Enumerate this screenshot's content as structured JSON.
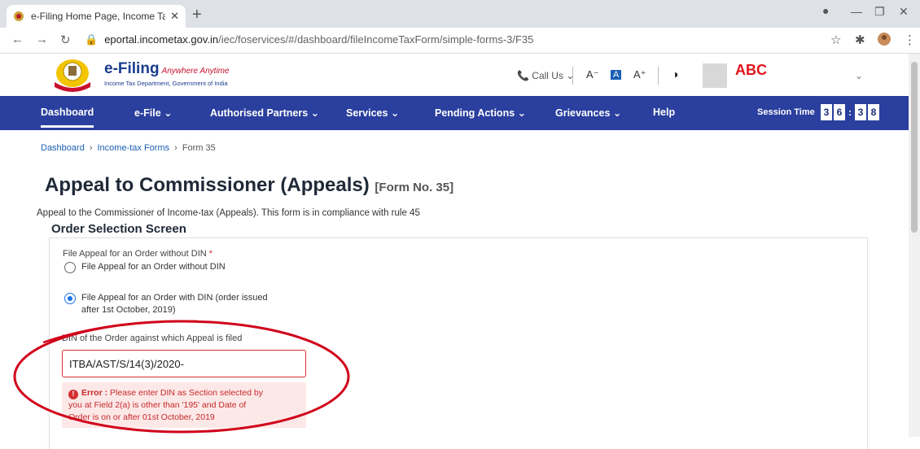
{
  "browser": {
    "tab_title": "e-Filing Home Page, Income Tax",
    "url_host": "eportal.incometax.gov.in",
    "url_path": "/iec/foservices/#/dashboard/fileIncomeTaxForm/simple-forms-3/F35"
  },
  "header": {
    "brand_title": "e-Filing",
    "brand_tagline": "Anywhere Anytime",
    "brand_subtitle": "Income Tax Department, Government of India",
    "call_us": "Call Us",
    "font_decrease": "A⁻",
    "font_reset": "A",
    "font_increase": "A⁺",
    "username": "ABC"
  },
  "nav": {
    "items": [
      {
        "label": "Dashboard"
      },
      {
        "label": "e-File ⌄"
      },
      {
        "label": "Authorised Partners ⌄"
      },
      {
        "label": "Services ⌄"
      },
      {
        "label": "Pending Actions ⌄"
      },
      {
        "label": "Grievances ⌄"
      },
      {
        "label": "Help"
      }
    ],
    "session_label": "Session Time",
    "session_digits": [
      "3",
      "6",
      ":",
      "3",
      "8"
    ]
  },
  "breadcrumb": {
    "items": [
      "Dashboard",
      "Income-tax Forms",
      "Form 35"
    ]
  },
  "page": {
    "title": "Appeal to Commissioner (Appeals)",
    "form_no": "[Form No. 35]",
    "description": "Appeal to the Commissioner of Income-tax (Appeals). This form is in compliance with rule 45",
    "section_title": "Order Selection Screen"
  },
  "form": {
    "field_label": "File Appeal for an Order without DIN",
    "required_mark": "*",
    "option_without_din": "File Appeal for an Order without DIN",
    "option_with_din_line1": "File Appeal for an Order with DIN (order issued",
    "option_with_din_line2": "after 1st October, 2019)",
    "din_label": "DIN of the Order against which Appeal is filed",
    "din_value": "ITBA/AST/S/14(3)/2020-",
    "error_prefix": "Error :",
    "error_line1": "Please enter DIN as Section selected by",
    "error_line2": "you at Field 2(a) is other than '195' and Date of",
    "error_line3": "Order is on or after 01st October, 2019"
  },
  "colors": {
    "nav_bg": "#2a3f9e",
    "error": "#d32f2f",
    "annotation": "#d0021b",
    "accent": "#1a73e8"
  },
  "icons": [
    "favicon-icon",
    "close-icon",
    "plus-icon",
    "back-icon",
    "forward-icon",
    "reload-icon",
    "lock-icon",
    "star-icon",
    "extension-icon",
    "profile-icon",
    "menu-icon",
    "phone-icon",
    "contrast-icon",
    "chevron-down-icon",
    "error-icon"
  ]
}
